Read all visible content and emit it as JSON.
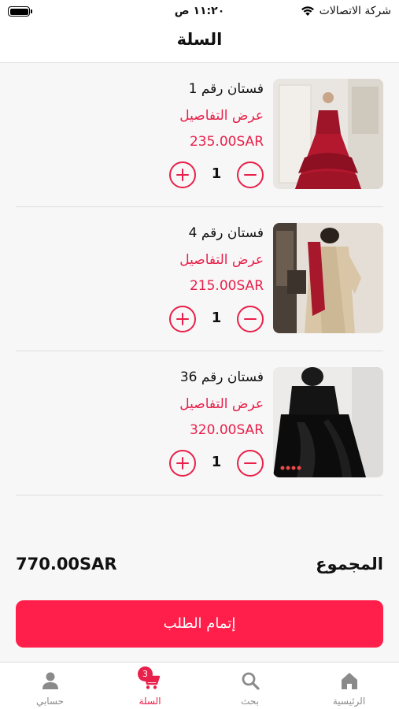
{
  "status_bar": {
    "time": "١١:٢٠ ص",
    "carrier": "شركة الاتصالات"
  },
  "header": {
    "title": "السلة"
  },
  "cart": {
    "items": [
      {
        "name": "فستان رقم 1",
        "details_link": "عرض التفاصيل",
        "price": "235.00SAR",
        "quantity": "1",
        "image_icon": "red-gown-photo"
      },
      {
        "name": "فستان رقم 4",
        "details_link": "عرض التفاصيل",
        "price": "215.00SAR",
        "quantity": "1",
        "image_icon": "beige-abaya-photo"
      },
      {
        "name": "فستان رقم 36",
        "details_link": "عرض التفاصيل",
        "price": "320.00SAR",
        "quantity": "1",
        "image_icon": "black-gown-photo"
      }
    ]
  },
  "summary": {
    "total_label": "المجموع",
    "total_value": "770.00SAR"
  },
  "checkout": {
    "label": "إتمام الطلب"
  },
  "tab_bar": {
    "tabs": [
      {
        "label": "حسابي",
        "icon": "person-icon"
      },
      {
        "label": "السلة",
        "icon": "cart-icon",
        "badge": "3",
        "active": true
      },
      {
        "label": "بحث",
        "icon": "search-icon"
      },
      {
        "label": "الرئيسية",
        "icon": "home-icon"
      }
    ]
  },
  "colors": {
    "accent": "#e8204a",
    "button": "#ff1f4a",
    "inactive_tab": "#8a8a8a"
  }
}
